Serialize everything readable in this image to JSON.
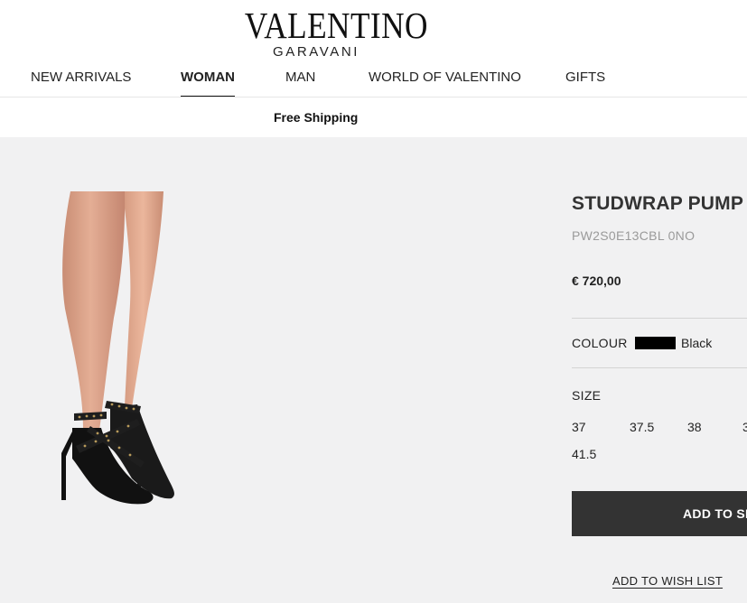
{
  "brand": {
    "name": "VALENTINO",
    "sub": "GARAVANI"
  },
  "nav": {
    "items": [
      {
        "label": "NEW ARRIVALS"
      },
      {
        "label": "WOMAN"
      },
      {
        "label": "MAN"
      },
      {
        "label": "WORLD OF VALENTINO"
      },
      {
        "label": "GIFTS"
      }
    ],
    "active": "WOMAN"
  },
  "promo": {
    "shipping": "Free Shipping"
  },
  "product": {
    "title": "STUDWRAP PUMP",
    "sku": "PW2S0E13CBL 0NO",
    "price": "€ 720,00",
    "colour_label": "COLOUR",
    "colour_value": "Black",
    "colour_hex": "#000000",
    "size_label": "SIZE",
    "sizes": [
      "37",
      "37.5",
      "38",
      "3",
      "41.5"
    ],
    "add_to_bag": "ADD TO SH",
    "wishlist": "ADD TO WISH LIST"
  },
  "colors": {
    "page_bg": "#f1f1f2",
    "button_bg": "#333333",
    "text": "#222222",
    "muted": "#9a9a9a"
  }
}
